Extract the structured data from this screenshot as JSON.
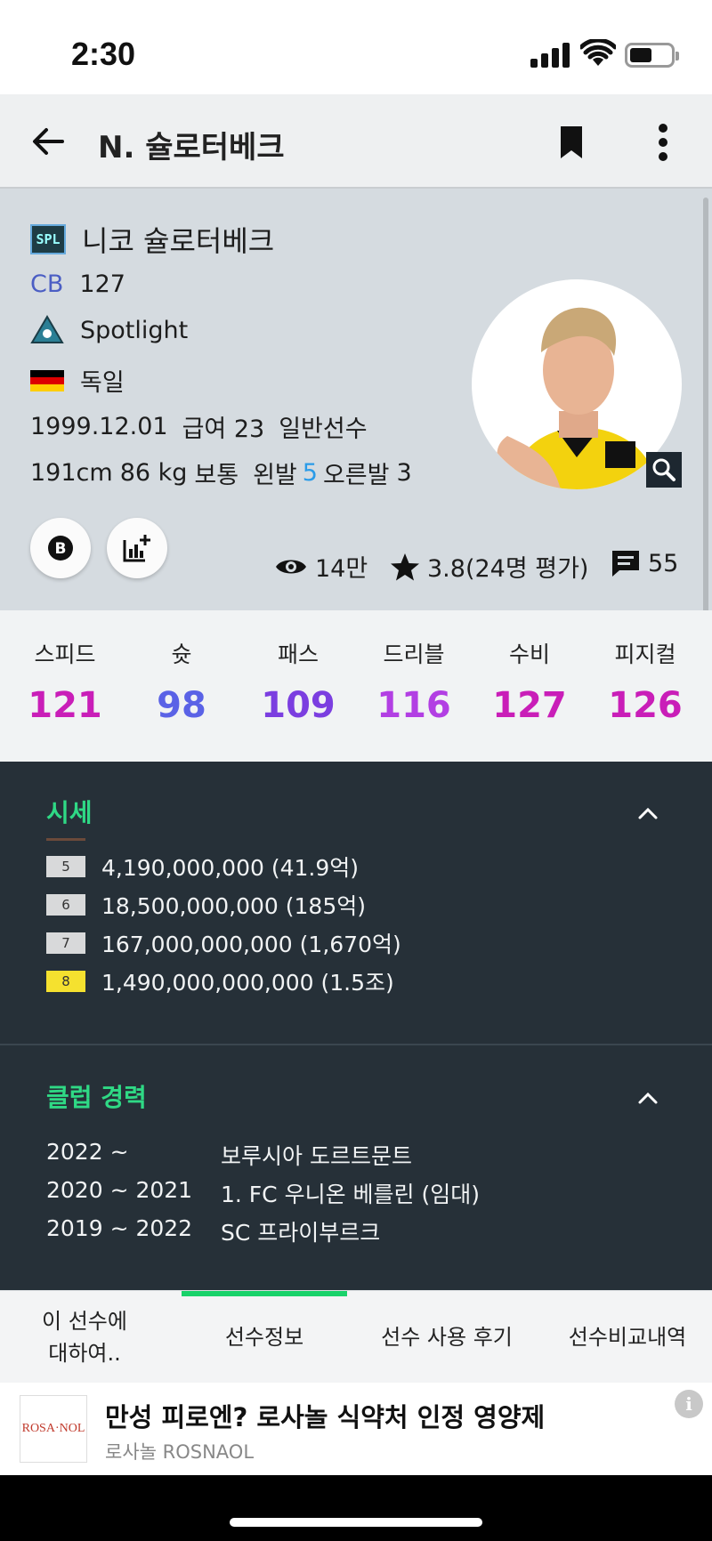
{
  "status_bar": {
    "time": "2:30"
  },
  "app_bar": {
    "title": "N. 슐로터베크"
  },
  "profile": {
    "season_badge": "SPL",
    "name": "니코 슐로터베크",
    "position": "CB",
    "ovr": "127",
    "team_tag": "Spotlight",
    "nation": "독일",
    "birth": "1999.12.01",
    "salary": "급여 23",
    "type": "일반선수",
    "height": "191cm",
    "weight": "86 kg",
    "body": "보통",
    "left_foot_label": "왼발",
    "left_foot": "5",
    "right_foot_label": "오른발",
    "right_foot": "3",
    "views": "14만",
    "rating": "3.8(24명 평가)",
    "comments": "55"
  },
  "attributes": [
    {
      "label": "스피드",
      "value": "121",
      "color": "#c91eb8"
    },
    {
      "label": "슛",
      "value": "98",
      "color": "#5a62e6"
    },
    {
      "label": "패스",
      "value": "109",
      "color": "#7b3ee0"
    },
    {
      "label": "드리블",
      "value": "116",
      "color": "#b23fe3"
    },
    {
      "label": "수비",
      "value": "127",
      "color": "#c91eb8"
    },
    {
      "label": "피지컬",
      "value": "126",
      "color": "#c91eb8"
    }
  ],
  "price_section": {
    "title": "시세",
    "rows": [
      {
        "level": "5",
        "price": "4,190,000,000 (41.9억)"
      },
      {
        "level": "6",
        "price": "18,500,000,000 (185억)"
      },
      {
        "level": "7",
        "price": "167,000,000,000 (1,670억)"
      },
      {
        "level": "8",
        "price": "1,490,000,000,000 (1.5조)"
      }
    ]
  },
  "career_section": {
    "title": "클럽 경력",
    "rows": [
      {
        "years": "2022  ~",
        "team": "보루시아 도르트문트"
      },
      {
        "years": "2020  ~ 2021",
        "team": "1. FC 우니온 베를린 (임대)"
      },
      {
        "years": "2019  ~ 2022",
        "team": "SC 프라이부르크"
      }
    ]
  },
  "tabs": {
    "about": "이 선수에 대하여..",
    "info": "선수정보",
    "reviews": "선수 사용 후기",
    "compare": "선수비교내역"
  },
  "ad": {
    "logo_text": "ROSA·NOL",
    "title": "만성 피로엔? 로사놀 식약처 인정 영양제",
    "subtitle": "로사놀 ROSNAOL"
  },
  "colors": {
    "accent_green": "#2fd985",
    "tab_indicator": "#19d26a",
    "dark_bg": "#263038"
  }
}
